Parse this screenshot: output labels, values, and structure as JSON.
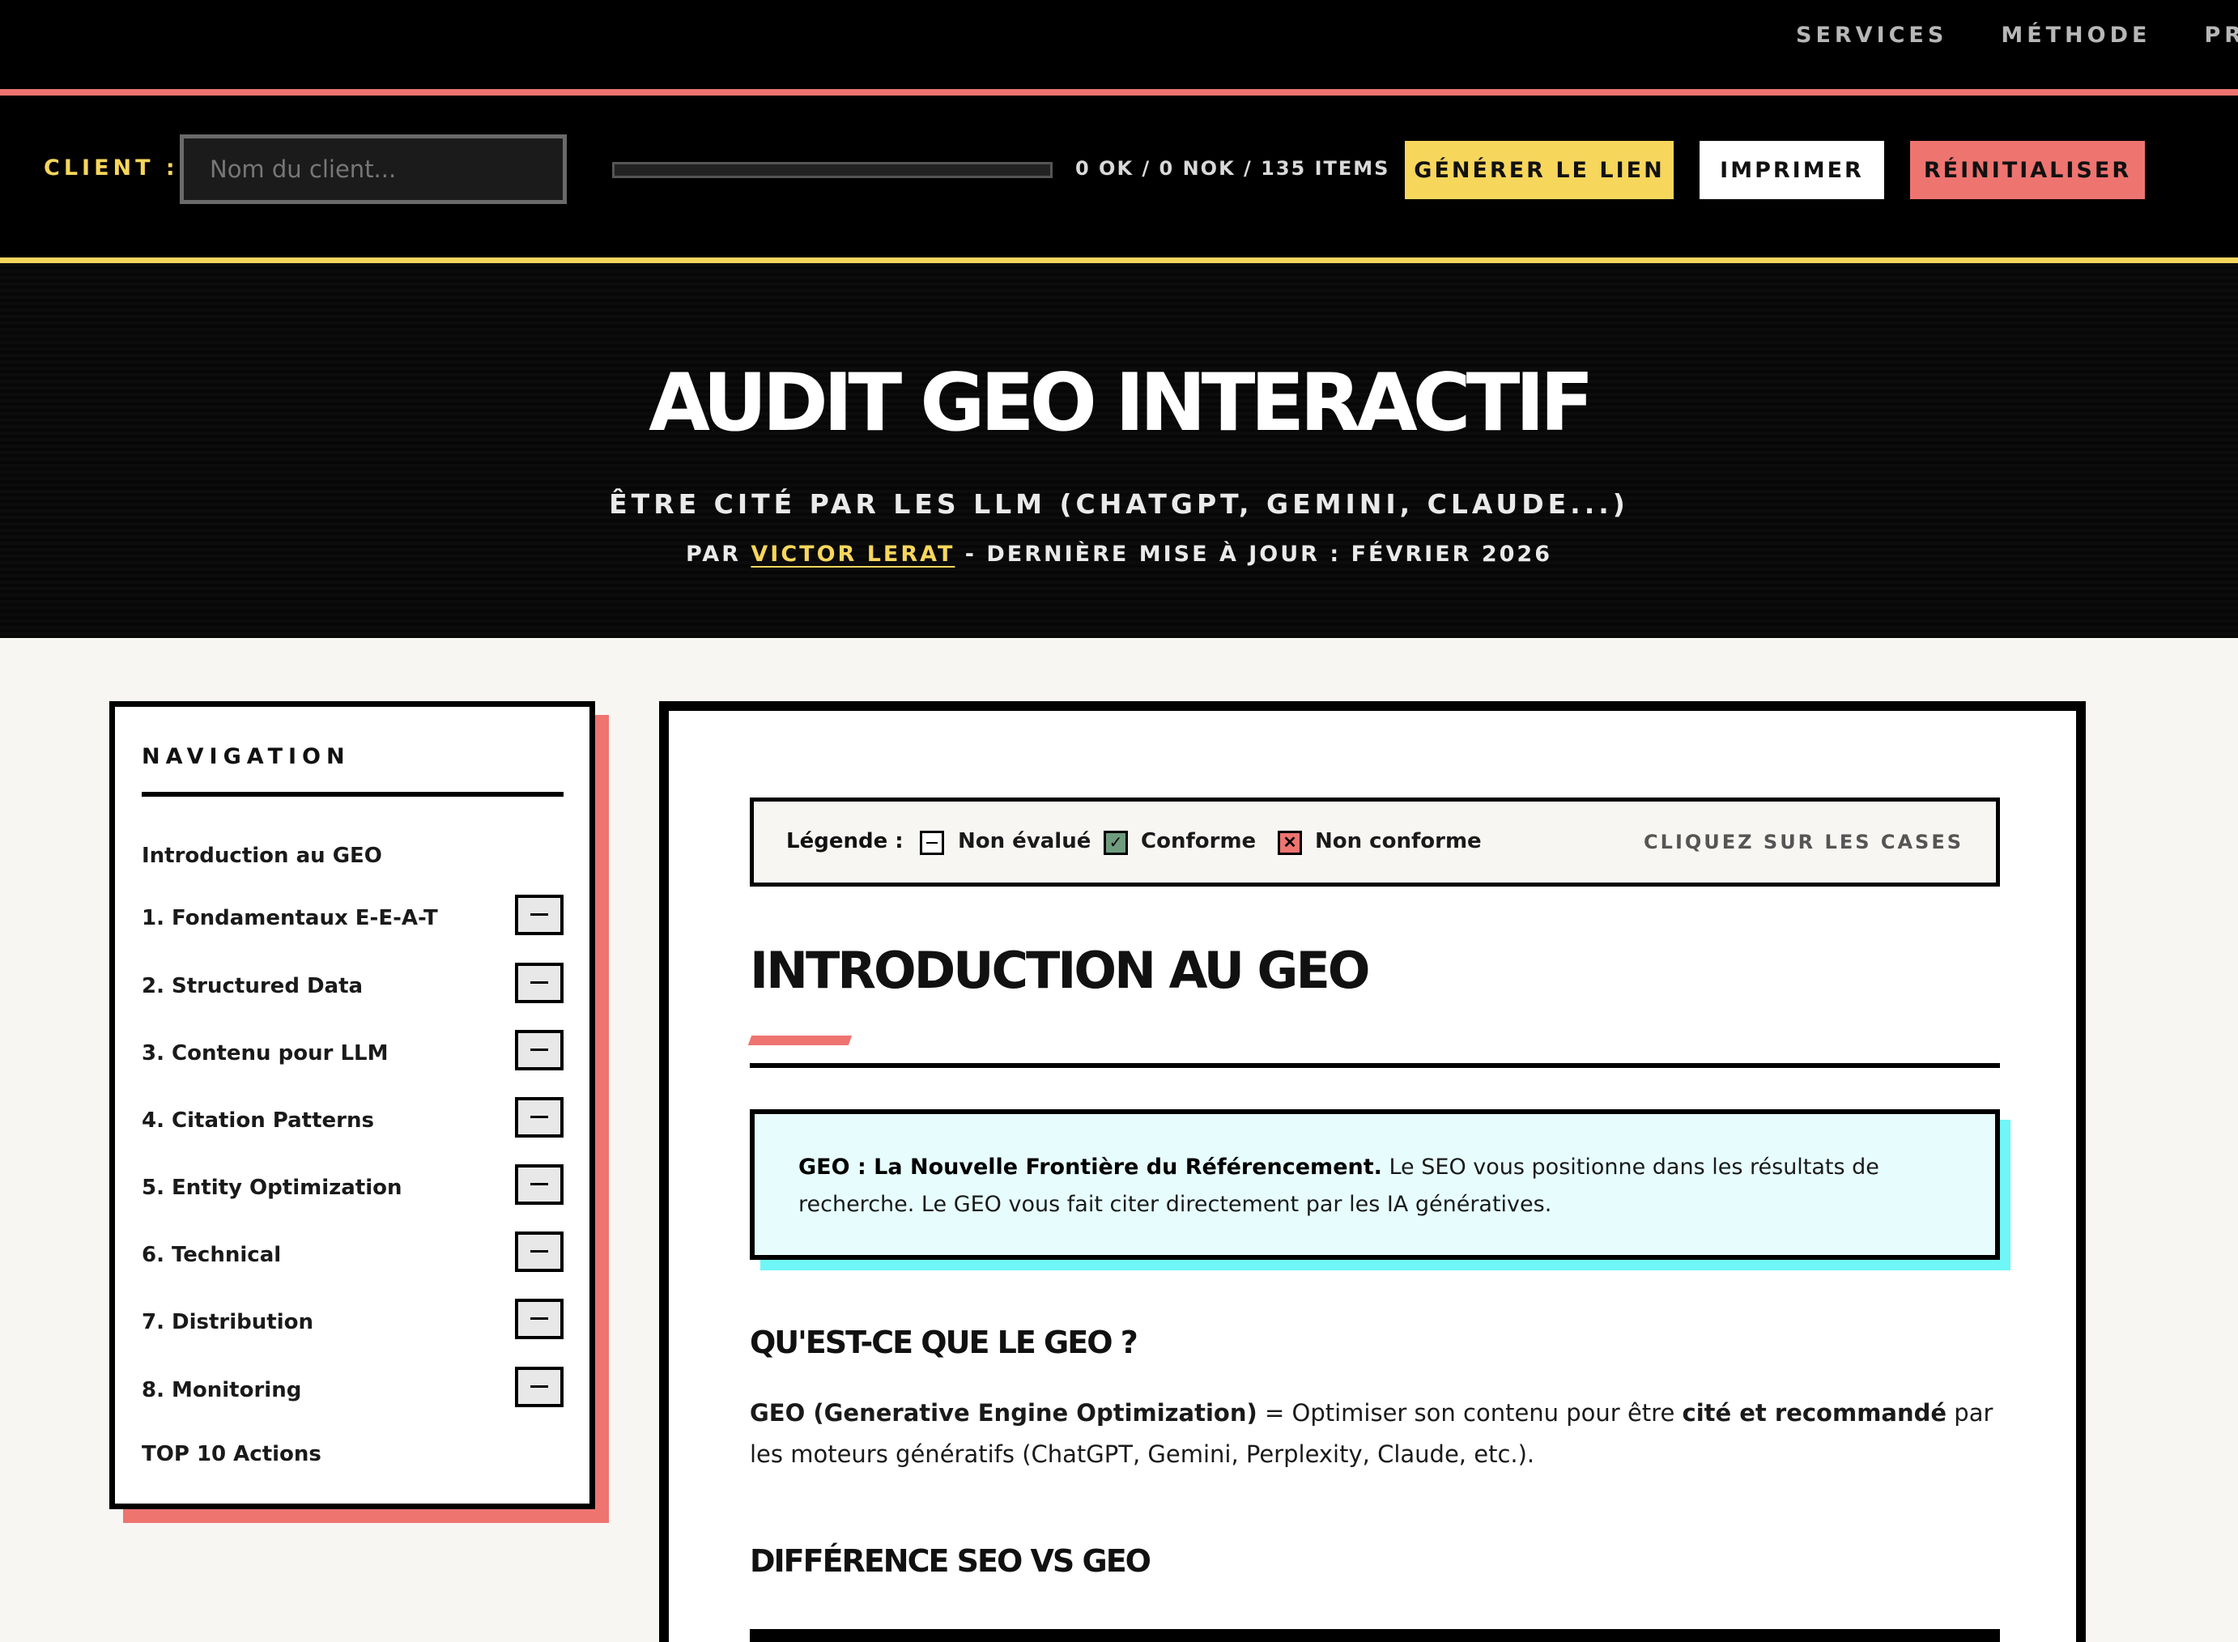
{
  "topnav": {
    "links": [
      "SERVICES",
      "MÉTHODE",
      "PROFI"
    ]
  },
  "toolbar": {
    "client_label": "CLIENT :",
    "client_placeholder": "Nom du client...",
    "client_value": "",
    "progress_fraction": 0,
    "progress_text": "0 OK / 0 NOK / 135 ITEMS",
    "generate_label": "GÉNÉRER LE LIEN",
    "print_label": "IMPRIMER",
    "reset_label": "RÉINITIALISER"
  },
  "hero": {
    "title": "AUDIT GEO INTERACTIF",
    "subtitle": "ÊTRE CITÉ PAR LES LLM (CHATGPT, GEMINI, CLAUDE...)",
    "meta_prefix": "PAR ",
    "author": "VICTOR LERAT",
    "meta_suffix": " - DERNIÈRE MISE À JOUR : FÉVRIER 2026"
  },
  "sidebar": {
    "title": "NAVIGATION",
    "items": [
      {
        "label": "Introduction au GEO",
        "status": "none"
      },
      {
        "label": "1. Fondamentaux E-E-A-T",
        "status": "unrated"
      },
      {
        "label": "2. Structured Data",
        "status": "unrated"
      },
      {
        "label": "3. Contenu pour LLM",
        "status": "unrated"
      },
      {
        "label": "4. Citation Patterns",
        "status": "unrated"
      },
      {
        "label": "5. Entity Optimization",
        "status": "unrated"
      },
      {
        "label": "6. Technical",
        "status": "unrated"
      },
      {
        "label": "7. Distribution",
        "status": "unrated"
      },
      {
        "label": "8. Monitoring",
        "status": "unrated"
      },
      {
        "label": "TOP 10 Actions",
        "status": "none"
      }
    ]
  },
  "legend": {
    "title": "Légende :",
    "unrated": "Non évalué",
    "ok": "Conforme",
    "nok": "Non conforme",
    "hint": "CLIQUEZ SUR LES CASES"
  },
  "content": {
    "title": "INTRODUCTION AU GEO",
    "callout_bold": "GEO : La Nouvelle Frontière du Référencement.",
    "callout_text": " Le SEO vous positionne dans les résultats de recherche. Le GEO vous fait citer directement par les IA génératives.",
    "h_what": "QU'EST-CE QUE LE GEO ?",
    "para_bold1": "GEO (Generative Engine Optimization)",
    "para_text1": " = Optimiser son contenu pour être ",
    "para_bold2": "cité et recommandé",
    "para_text2": " par les moteurs génératifs (ChatGPT, Gemini, Perplexity, Claude, etc.).",
    "h_diff": "DIFFÉRENCE SEO VS GEO"
  },
  "colors": {
    "accent_red": "#ee7470",
    "accent_yellow": "#f7d65c",
    "accent_cyan": "#6ff6f6",
    "ok_green": "#6f9c7f"
  },
  "icons": {
    "unrated": "minus-box-icon",
    "ok": "check-box-icon",
    "nok": "cross-box-icon"
  }
}
